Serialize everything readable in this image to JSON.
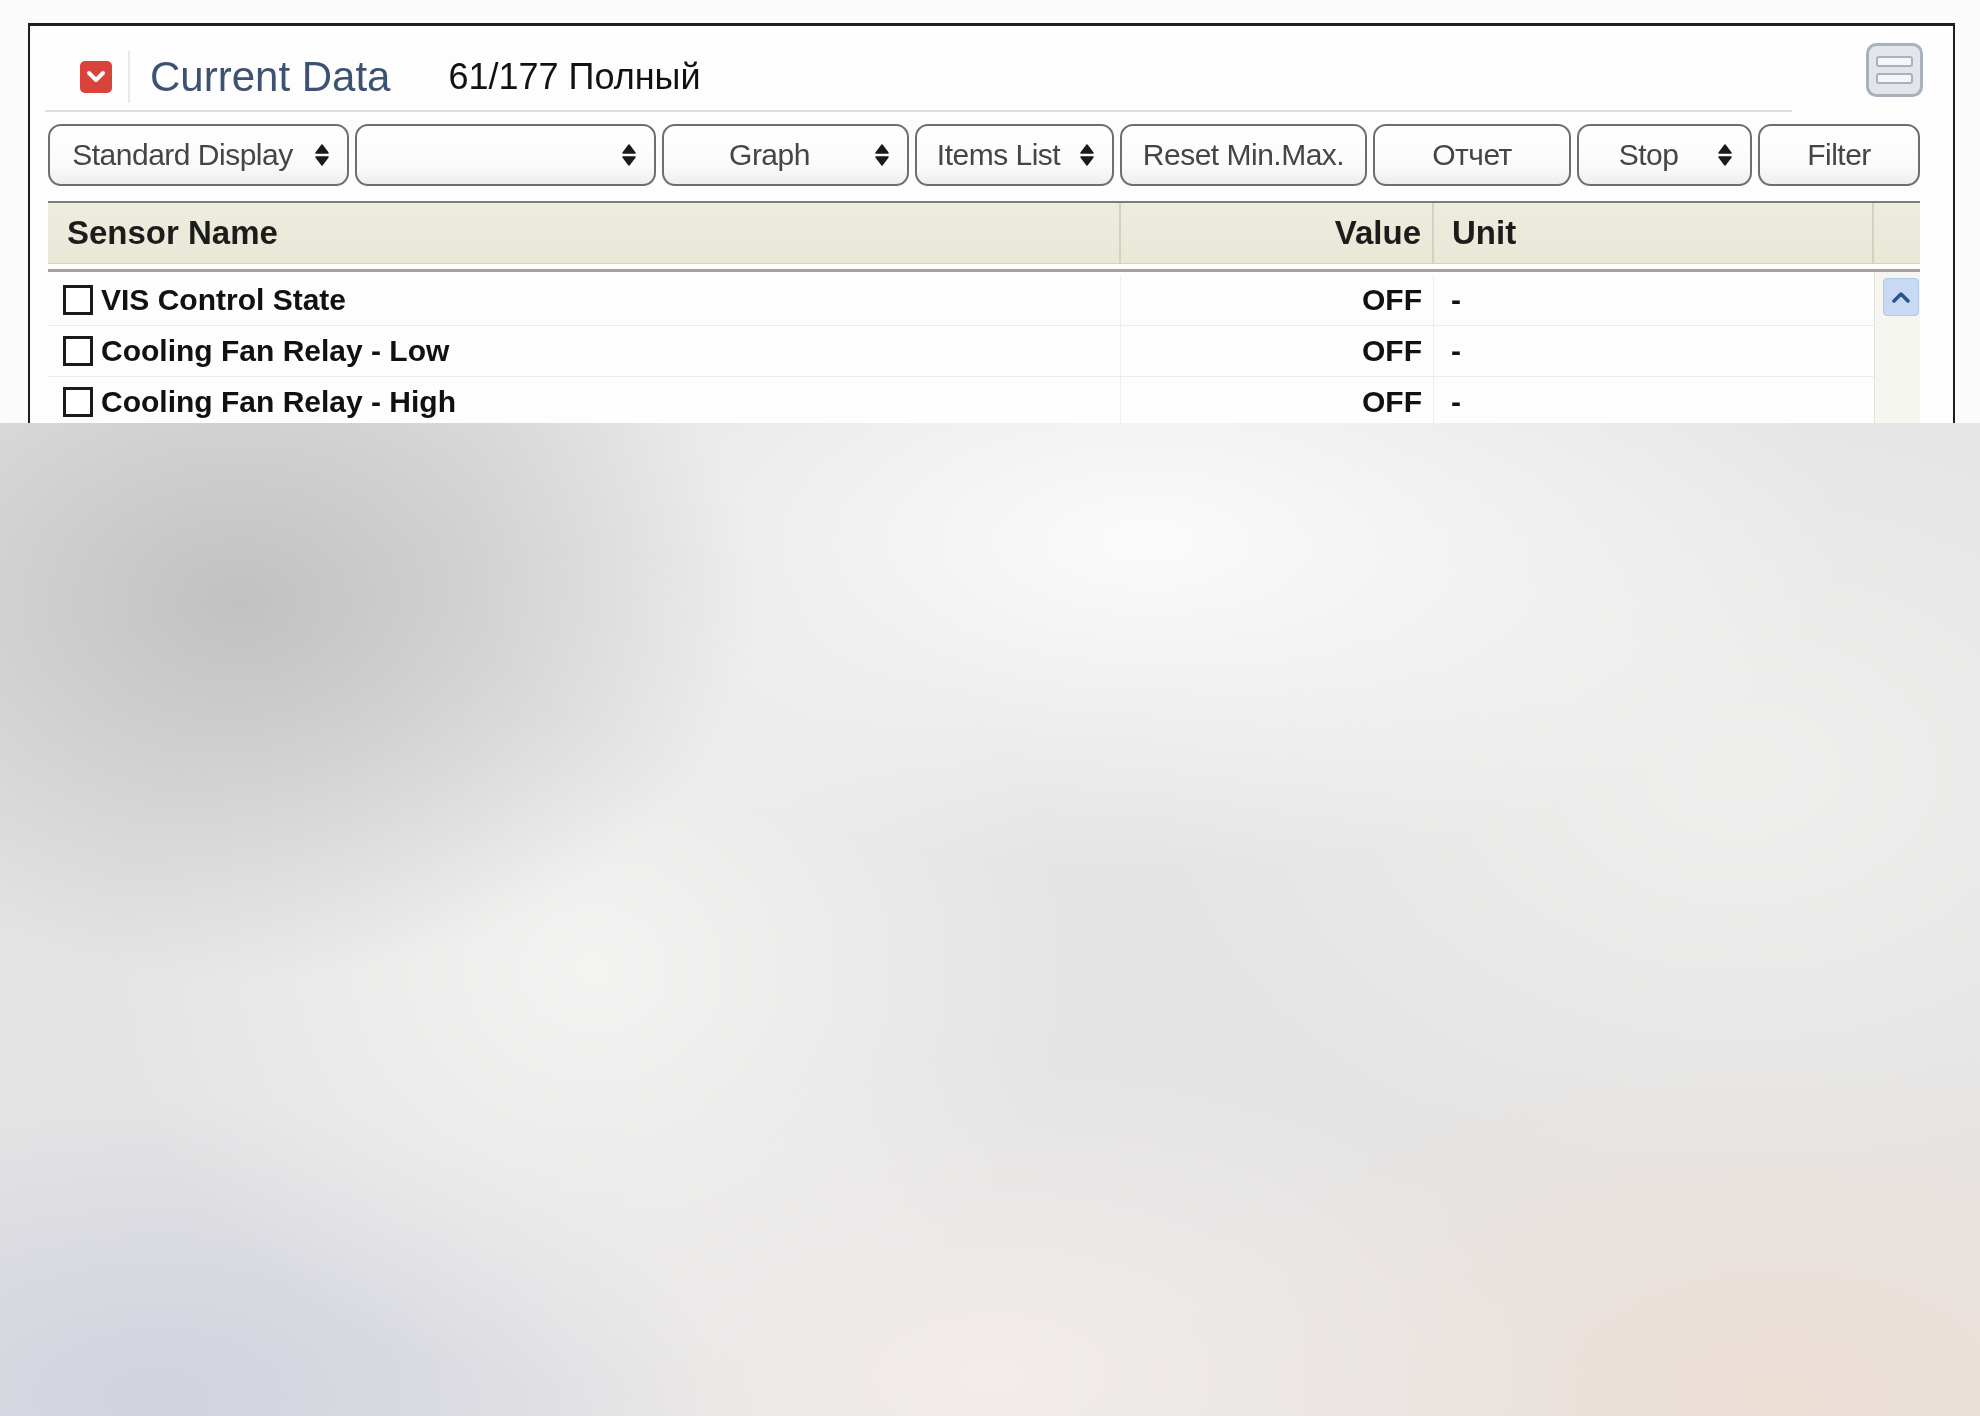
{
  "panel": {
    "title": "Current Data",
    "count": "61/177 Полный"
  },
  "toolbar": [
    {
      "kind": "dropdown",
      "label": "Standard Display"
    },
    {
      "kind": "dropdown"
    },
    {
      "kind": "dropdown",
      "label": "Graph"
    },
    {
      "kind": "dropdown",
      "label": "Items List"
    },
    {
      "kind": "button",
      "label": "Reset Min.Max."
    },
    {
      "kind": "button",
      "label": "Отчет"
    },
    {
      "kind": "dropdown",
      "label": "Stop"
    },
    {
      "kind": "button",
      "label": "Filter"
    }
  ],
  "table": {
    "columns": [
      "Sensor Name",
      "Value",
      "Unit"
    ],
    "rows": [
      {
        "name": "VIS Control State",
        "checked": false,
        "value": "OFF",
        "unit": "-"
      },
      {
        "name": "Cooling Fan Relay - Low",
        "checked": false,
        "value": "OFF",
        "unit": "-"
      },
      {
        "name": "Cooling Fan Relay - High",
        "checked": false,
        "value": "OFF",
        "unit": "-"
      }
    ]
  }
}
